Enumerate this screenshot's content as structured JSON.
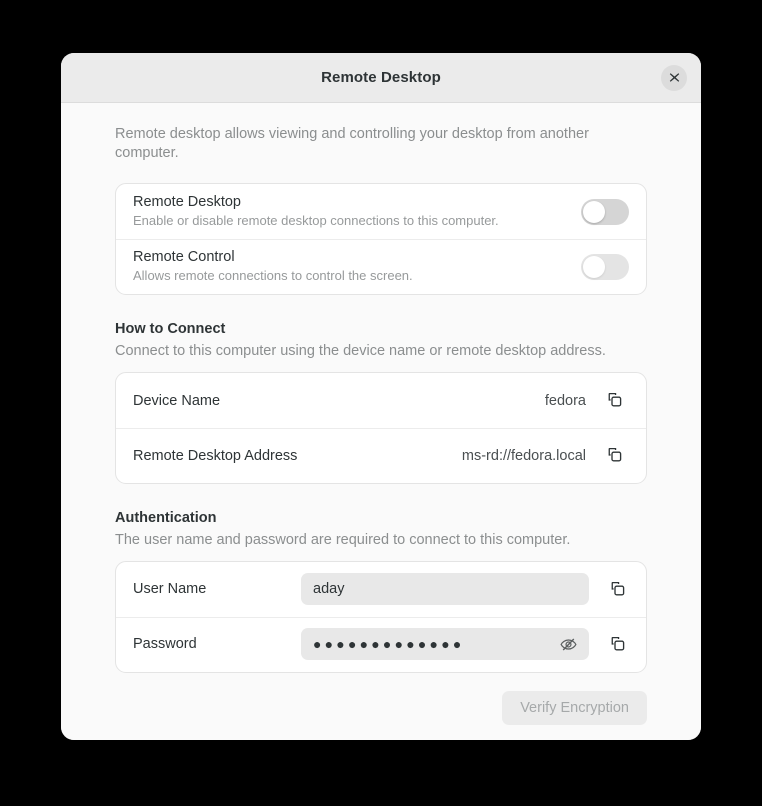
{
  "window": {
    "title": "Remote Desktop",
    "close_icon": "close-icon",
    "intro": "Remote desktop allows viewing and controlling your desktop from another computer."
  },
  "toggles": {
    "rows": [
      {
        "title": "Remote Desktop",
        "subtitle": "Enable or disable remote desktop connections to this computer.",
        "state": "off"
      },
      {
        "title": "Remote Control",
        "subtitle": "Allows remote connections to control the screen.",
        "state": "off"
      }
    ]
  },
  "how_to_connect": {
    "heading": "How to Connect",
    "description": "Connect to this computer using the device name or remote desktop address.",
    "rows": [
      {
        "label": "Device Name",
        "value": "fedora",
        "copy_icon": "copy-icon"
      },
      {
        "label": "Remote Desktop Address",
        "value": "ms-rd://fedora.local",
        "copy_icon": "copy-icon"
      }
    ]
  },
  "authentication": {
    "heading": "Authentication",
    "description": "The user name and password are required to connect to this computer.",
    "username": {
      "label": "User Name",
      "value": "aday",
      "placeholder": "User Name",
      "copy_icon": "copy-icon"
    },
    "password": {
      "label": "Password",
      "value": "●●●●●●●●●●●●●",
      "placeholder": "Password",
      "reveal_icon": "eye-off-icon",
      "copy_icon": "copy-icon"
    },
    "verify_button": "Verify Encryption"
  },
  "colors": {
    "page_background": "#000000",
    "window_background": "#fafafa",
    "titlebar": "#ebebeb",
    "card": "#ffffff",
    "text_primary": "#2e3436",
    "text_muted": "#8b8e8f",
    "entry_fill": "#e8e8e8",
    "switch_off": "#d5d5d5",
    "disabled_button_text": "#a6a9aa"
  }
}
